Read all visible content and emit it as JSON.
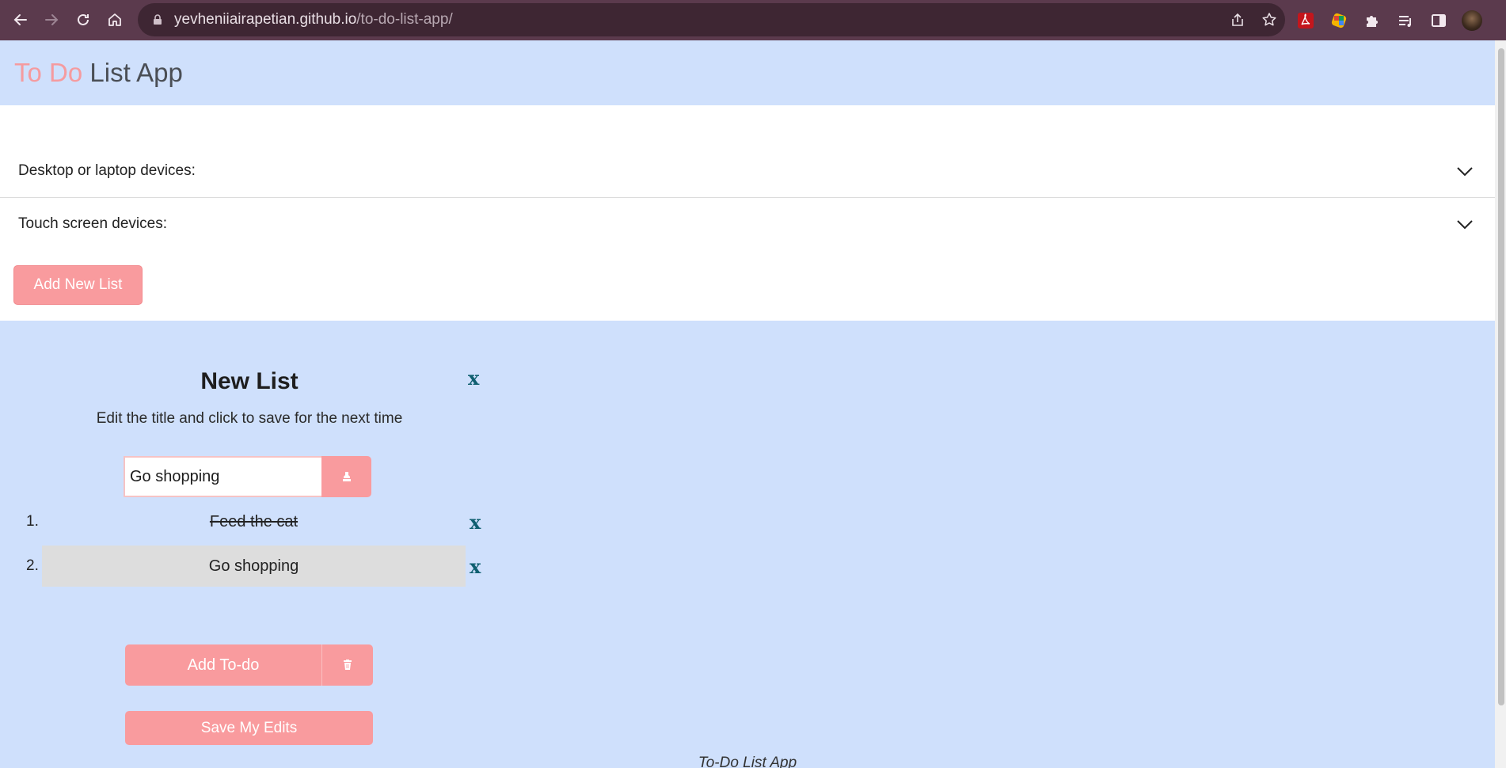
{
  "browser": {
    "url_host": "yevheniiairapetian.github.io",
    "url_path": "/to-do-list-app/",
    "icons": {
      "back": "arrow-left-icon",
      "forward": "arrow-right-icon",
      "reload": "reload-icon",
      "home": "home-icon",
      "lock": "lock-icon",
      "share": "share-icon",
      "bookmark": "star-icon",
      "extensions": [
        "pdf-extension-icon",
        "color-extension-icon",
        "puzzle-icon",
        "reading-list-icon",
        "side-panel-icon"
      ]
    }
  },
  "app": {
    "title_accent": "To Do",
    "title_rest": " List App",
    "accent_color": "#f59b9f",
    "header_bg": "#cfe0fc"
  },
  "accordion": [
    {
      "label": "Desktop or laptop devices:"
    },
    {
      "label": "Touch screen devices:"
    }
  ],
  "add_list_label": "Add New List",
  "list_card": {
    "title": "New List",
    "close_label": "x",
    "subtitle": "Edit the title and click to save for the next time",
    "title_input_value": "Go shopping",
    "todos": [
      {
        "number": "1.",
        "text": "Feed the cat",
        "done": true,
        "delete_label": "x"
      },
      {
        "number": "2.",
        "text": "Go shopping",
        "done": false,
        "delete_label": "x"
      }
    ],
    "add_todo_label": "Add To-do",
    "save_edits_label": "Save My Edits"
  },
  "footer_text": "To-Do List App",
  "button_color": "#f99b9e",
  "close_color": "#0f5f70"
}
